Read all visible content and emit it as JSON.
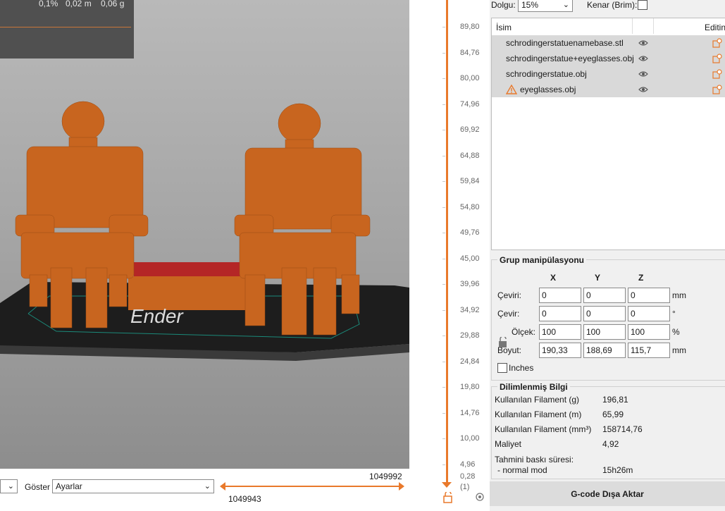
{
  "viewport": {
    "legend_values": [
      "0,1%",
      "0,02 m",
      "0,06 g"
    ],
    "bed_text": "Ender"
  },
  "bottom": {
    "goster_label": "Göster",
    "goster_value": "Ayarlar",
    "slider_max": "1049992",
    "slider_min": "1049943"
  },
  "vertical_slider": {
    "labels": [
      "89,80",
      "84,76",
      "80,00",
      "74,96",
      "69,92",
      "64,88",
      "59,84",
      "54,80",
      "49,76",
      "45,00",
      "39,96",
      "34,92",
      "29,88",
      "24,84",
      "19,80",
      "14,76",
      "10,00",
      "4,96"
    ],
    "bottom_value": "0,28",
    "bottom_layer": "(1)"
  },
  "settings": {
    "infill_label": "Dolgu:",
    "infill_value": "15%",
    "brim_label": "Kenar (Brim):"
  },
  "object_list": {
    "col_name": "İsim",
    "col_edit": "Editin",
    "items": [
      {
        "name": "schrodingerstatuenamebase.stl"
      },
      {
        "name": "schrodingerstatue+eyeglasses.obj"
      },
      {
        "name": "schrodingerstatue.obj"
      },
      {
        "name": "eyeglasses.obj"
      }
    ]
  },
  "manipulation": {
    "title": "Grup manipülasyonu",
    "axes": [
      "X",
      "Y",
      "Z"
    ],
    "rows": [
      {
        "label": "Çeviri:",
        "values": [
          "0",
          "0",
          "0"
        ],
        "unit": "mm"
      },
      {
        "label": "Çevir:",
        "values": [
          "0",
          "0",
          "0"
        ],
        "unit": "°"
      },
      {
        "label": "Ölçek:",
        "values": [
          "100",
          "100",
          "100"
        ],
        "unit": "%"
      },
      {
        "label": "Boyut:",
        "values": [
          "190,33",
          "188,69",
          "115,7"
        ],
        "unit": "mm"
      }
    ],
    "inches_label": "Inches"
  },
  "sliced_info": {
    "title": "Dilimlenmiş Bilgi",
    "rows": [
      {
        "label": "Kullanılan Filament (g)",
        "value": "196,81"
      },
      {
        "label": "Kullanılan Filament (m)",
        "value": "65,99"
      },
      {
        "label": "Kullanılan Filament (mm³)",
        "value": "158714,76"
      },
      {
        "label": "Maliyet",
        "value": "4,92"
      },
      {
        "label": "Tahmini baskı süresi:",
        "value": ""
      },
      {
        "label": "- normal mod",
        "value": "15h26m"
      }
    ]
  },
  "export_button": "G-code Dışa Aktar",
  "colors": {
    "accent": "#e9792b",
    "model": "#c8651f"
  }
}
